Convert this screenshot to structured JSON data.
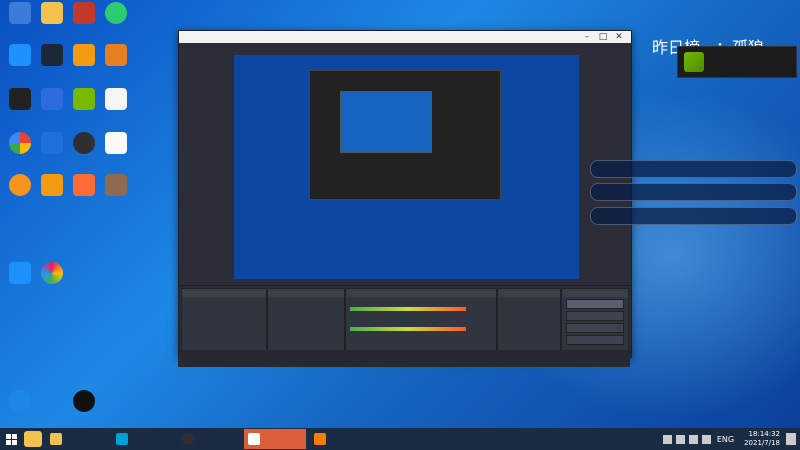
{
  "overlay": {
    "banner": "",
    "top_right_title": "昨日榜一：孤狼",
    "geforce_toast": ""
  },
  "desktop_icons": [
    {
      "label": ""
    },
    {
      "label": ""
    },
    {
      "label": ""
    },
    {
      "label": ""
    },
    {
      "label": ""
    },
    {
      "label": ""
    },
    {
      "label": ""
    },
    {
      "label": ""
    },
    {
      "label": ""
    },
    {
      "label": ""
    },
    {
      "label": ""
    },
    {
      "label": ""
    },
    {
      "label": ""
    },
    {
      "label": ""
    },
    {
      "label": ""
    },
    {
      "label": ""
    },
    {
      "label": ""
    },
    {
      "label": ""
    },
    {
      "label": ""
    },
    {
      "label": ""
    },
    {
      "label": ""
    },
    {
      "label": ""
    },
    {
      "label": ""
    },
    {
      "label": ""
    }
  ],
  "obs": {
    "title": "",
    "menu": [
      "",
      "",
      "",
      "",
      "",
      "",
      ""
    ],
    "panels": {
      "scenes": "",
      "sources": "",
      "mixer": "",
      "transitions": "",
      "controls": ""
    },
    "controls": [
      "",
      "",
      "",
      "",
      "",
      ""
    ]
  },
  "chat": [
    {
      "text": ""
    },
    {
      "text": ""
    },
    {
      "text": ""
    }
  ],
  "taskbar": {
    "items": [
      {
        "label": ""
      },
      {
        "label": ""
      },
      {
        "label": ""
      },
      {
        "label": ""
      },
      {
        "label": ""
      }
    ],
    "language": "ENG",
    "time": "18:14:32",
    "date": "2021/7/18"
  }
}
